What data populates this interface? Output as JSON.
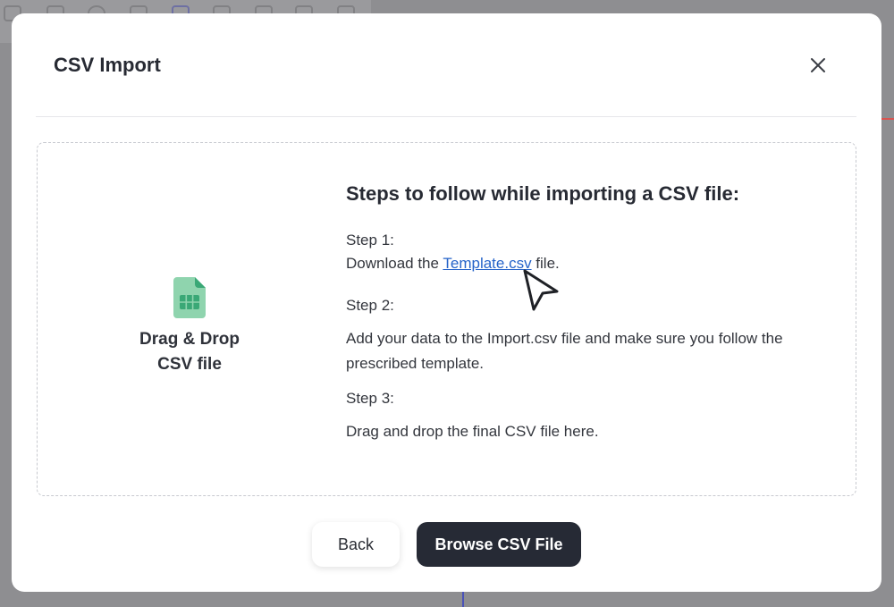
{
  "dialog": {
    "title": "CSV Import",
    "close_icon": "close-icon"
  },
  "dropzone": {
    "icon": "spreadsheet-file-icon",
    "icon_color": "#3aa876",
    "label_line1": "Drag & Drop",
    "label_line2": "CSV file"
  },
  "steps": {
    "title": "Steps to follow while importing a CSV file:",
    "step1_label": "Step 1:",
    "step1_prefix": "Download the ",
    "step1_link": "Template.csv",
    "step1_suffix": " file.",
    "step2_label": "Step 2:",
    "step2_text": "Add your data to the Import.csv file and make sure you follow the prescribed template.",
    "step3_label": "Step 3:",
    "step3_text": "Drag and drop the final CSV file here."
  },
  "footer": {
    "back_label": "Back",
    "browse_label": "Browse CSV File"
  },
  "colors": {
    "link": "#2563c9",
    "primary_button": "#262a35"
  }
}
